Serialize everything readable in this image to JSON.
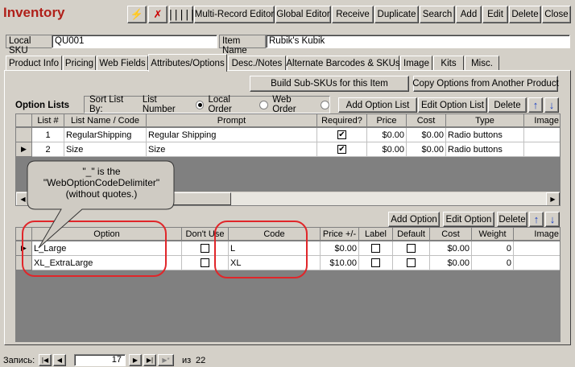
{
  "window": {
    "title": "Inventory"
  },
  "toolbar": {
    "multi_record_editor": "Multi-Record Editor",
    "global_editor": "Global Editor",
    "receive": "Receive",
    "duplicate": "Duplicate",
    "search": "Search",
    "add": "Add",
    "edit": "Edit",
    "delete": "Delete",
    "close": "Close"
  },
  "header": {
    "local_sku_label": "Local SKU",
    "local_sku_value": "QU001",
    "item_name_label": "Item Name",
    "item_name_value": "Rubik's Kubik"
  },
  "tabs": [
    "Product Info",
    "Pricing",
    "Web Fields",
    "Attributes/Options",
    "Desc./Notes",
    "Alternate Barcodes & SKUs",
    "Image",
    "Kits",
    "Misc."
  ],
  "actions": {
    "build_sub_skus": "Build Sub-SKUs for this Item",
    "copy_options": "Copy Options from Another Product"
  },
  "option_lists": {
    "title": "Option Lists",
    "sort_label": "Sort List By:",
    "sort_options": [
      "List Number",
      "Local Order",
      "Web Order"
    ],
    "sort_selected": "List Number",
    "add": "Add Option List",
    "edit": "Edit Option List",
    "delete": "Delete",
    "columns": [
      "List #",
      "List Name / Code",
      "Prompt",
      "Required?",
      "Price",
      "Cost",
      "Type",
      "Image"
    ],
    "rows": [
      {
        "num": "1",
        "name": "RegularShipping",
        "prompt": "Regular Shipping",
        "required": true,
        "price": "$0.00",
        "cost": "$0.00",
        "type": "Radio buttons",
        "image": ""
      },
      {
        "num": "2",
        "name": "Size",
        "prompt": "Size",
        "required": true,
        "price": "$0.00",
        "cost": "$0.00",
        "type": "Radio buttons",
        "image": ""
      }
    ]
  },
  "options": {
    "add": "Add Option",
    "edit": "Edit Option",
    "delete": "Delete",
    "columns": [
      "Option",
      "Don't Use",
      "Code",
      "Price +/-",
      "Label",
      "Default",
      "Cost",
      "Weight",
      "Image"
    ],
    "rows": [
      {
        "option": "L_Large",
        "dont_use": false,
        "code": "L",
        "price": "$0.00",
        "label": false,
        "default": false,
        "cost": "$0.00",
        "weight": "0"
      },
      {
        "option": "XL_ExtraLarge",
        "dont_use": false,
        "code": "XL",
        "price": "$10.00",
        "label": false,
        "default": false,
        "cost": "$0.00",
        "weight": "0"
      }
    ]
  },
  "callout": {
    "line1": "\"_\" is the",
    "line2": "\"WebOptionCodeDelimiter\"",
    "line3": "(without quotes.)"
  },
  "record_nav": {
    "label": "Запись:",
    "current": "17",
    "of_label": "из",
    "total": "22"
  },
  "colors": {
    "title": "#b0201a",
    "highlight": "#e0262a",
    "arrow_blue": "#1a3fc4"
  }
}
